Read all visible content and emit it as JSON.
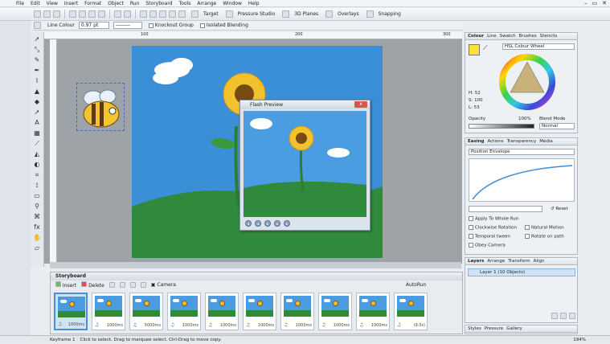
{
  "menu": [
    "File",
    "Edit",
    "View",
    "Insert",
    "Format",
    "Object",
    "Run",
    "Storyboard",
    "Tools",
    "Arrange",
    "Window",
    "Help"
  ],
  "toolbar": {
    "target_label": "Target",
    "pressure_label": "Pressure Studio",
    "planes_label": "3D Planes",
    "overlays_label": "Overlays",
    "snapping_label": "Snapping"
  },
  "context": {
    "line_colour_label": "Line Colour",
    "line_width": "0.97 pt",
    "knockout_label": "Knockout Group",
    "isolated_label": "Isolated Blending"
  },
  "ruler": {
    "t100": "100",
    "t200": "200",
    "t300": "300"
  },
  "preview": {
    "title": "Flash Preview",
    "close": "x"
  },
  "storyboard": {
    "title": "Storyboard",
    "insert": "Insert",
    "delete": "Delete",
    "camera": "Camera",
    "autorun": "AutoRun",
    "frames": [
      {
        "dur": "1000ms"
      },
      {
        "dur": "1000ms"
      },
      {
        "dur": "5000ms"
      },
      {
        "dur": "1000ms"
      },
      {
        "dur": "1000ms"
      },
      {
        "dur": "1000ms"
      },
      {
        "dur": "1000ms"
      },
      {
        "dur": "1000ms"
      },
      {
        "dur": "1000ms"
      },
      {
        "dur": "(9.0s)"
      }
    ]
  },
  "status": {
    "keyframe": "Keyframe 1",
    "hint": "Click to select. Drag to marquee select. Ctrl-Drag to move copy.",
    "zoom": "194%"
  },
  "colour_panel": {
    "tabs": [
      "Colour",
      "Line",
      "Swatch",
      "Brushes",
      "Stencils"
    ],
    "mode": "HSL Colour Wheel",
    "h": "H: 52",
    "s": "S: 100",
    "l": "L: 53",
    "opacity_label": "Opacity",
    "opacity_value": "100%",
    "blend_label": "Blend Mode",
    "blend_value": "Normal"
  },
  "easing_panel": {
    "tabs": [
      "Easing",
      "Actions",
      "Transparency",
      "Media"
    ],
    "envelope": "Position Envelope",
    "reset": "Reset",
    "apply_all": "Apply To Whole Run",
    "clockwise": "Clockwise Rotation",
    "natural": "Natural Motion",
    "temporal": "Temporal tween",
    "rotate_path": "Rotate on path",
    "obey_camera": "Obey Camera"
  },
  "layers_panel": {
    "tabs": [
      "Layers",
      "Arrange",
      "Transform",
      "Align"
    ],
    "layer": "Layer 1 (10 Objects)"
  },
  "styles_panel": {
    "tabs": [
      "Styles",
      "Pressure",
      "Gallery"
    ]
  },
  "colors": {
    "sky": "#3a8fd6",
    "ground": "#2f8a3c",
    "accent": "#4a90d9",
    "sun": "#f2c12e"
  }
}
